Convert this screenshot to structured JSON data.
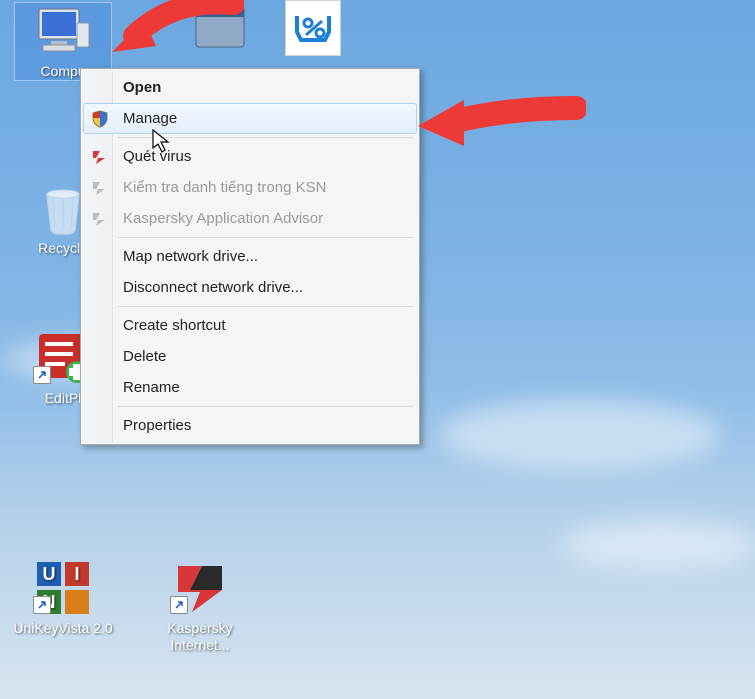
{
  "desktop": {
    "icons": {
      "computer": {
        "label": "Compu"
      },
      "recycle": {
        "label": "Recycle"
      },
      "editplus": {
        "label": "EditPl"
      },
      "unikey": {
        "label": "UniKeyVista 2.0"
      },
      "kaspersky": {
        "label": "Kaspersky Internet..."
      },
      "percent": {
        "label": ""
      }
    }
  },
  "menu": {
    "open": "Open",
    "manage": "Manage",
    "scan": "Quét virus",
    "ksn": "Kiểm tra danh tiếng trong KSN",
    "advisor": "Kaspersky Application Advisor",
    "map": "Map network drive...",
    "disconnect": "Disconnect network drive...",
    "shortcut": "Create shortcut",
    "delete": "Delete",
    "rename": "Rename",
    "properties": "Properties"
  }
}
